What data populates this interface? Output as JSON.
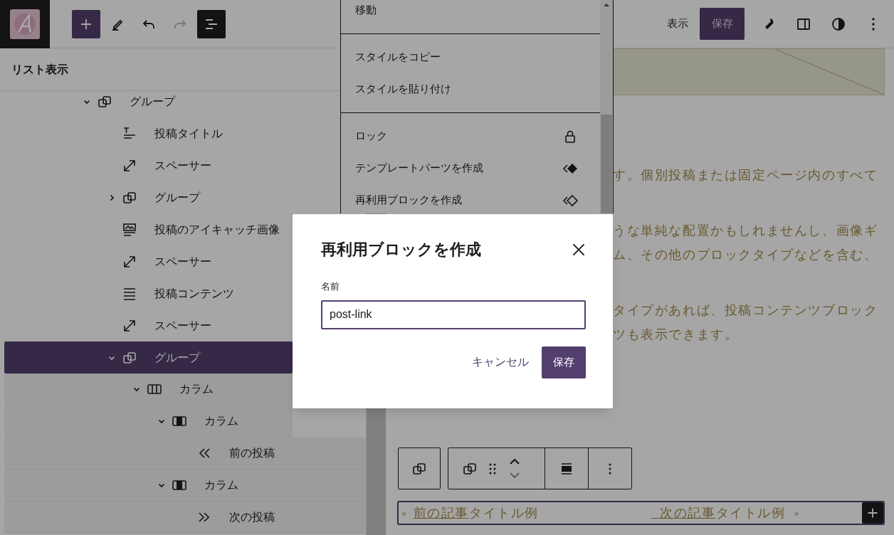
{
  "toolbar": {
    "tools": [
      {
        "kind": "inserter",
        "disabled": false,
        "pressed": false
      },
      {
        "kind": "tools",
        "disabled": false,
        "pressed": false
      },
      {
        "kind": "undo",
        "disabled": false,
        "pressed": false
      },
      {
        "kind": "redo",
        "disabled": true,
        "pressed": false
      },
      {
        "kind": "list-view",
        "disabled": false,
        "pressed": true
      }
    ],
    "view_button": "表示",
    "save_button": "保存",
    "actions": [
      {
        "kind": "settings"
      },
      {
        "kind": "sidebar"
      },
      {
        "kind": "styles"
      },
      {
        "kind": "options"
      }
    ]
  },
  "list_view": {
    "title": "リスト表示",
    "items": [
      {
        "label": "グループ",
        "kind": "group",
        "expanded": true,
        "selected": false,
        "children": [
          {
            "label": "投稿タイトル",
            "kind": "post-title",
            "selected": false
          },
          {
            "label": "スペーサー",
            "kind": "spacer",
            "selected": false
          },
          {
            "label": "グループ",
            "kind": "group",
            "expanded": false,
            "selected": false
          },
          {
            "label": "投稿のアイキャッチ画像",
            "kind": "featured-image",
            "selected": false
          },
          {
            "label": "スペーサー",
            "kind": "spacer",
            "selected": false
          },
          {
            "label": "投稿コンテンツ",
            "kind": "post-content",
            "selected": false
          },
          {
            "label": "スペーサー",
            "kind": "spacer",
            "selected": false
          },
          {
            "label": "グループ",
            "kind": "group",
            "expanded": true,
            "selected": true,
            "children": [
              {
                "label": "カラム",
                "kind": "columns",
                "expanded": true,
                "selected": false,
                "children": [
                  {
                    "label": "カラム",
                    "kind": "column",
                    "expanded": true,
                    "selected": false,
                    "children": [
                      {
                        "label": "前の投稿",
                        "kind": "previous-post",
                        "selected": false
                      }
                    ]
                  },
                  {
                    "label": "カラム",
                    "kind": "column",
                    "expanded": true,
                    "selected": false,
                    "children": [
                      {
                        "label": "次の投稿",
                        "kind": "next-post",
                        "selected": false
                      }
                    ]
                  }
                ]
              }
            ]
          }
        ]
      }
    ]
  },
  "block_menu": {
    "groups": [
      [
        {
          "label": "移動",
          "kind": "plain"
        }
      ],
      [
        {
          "label": "スタイルをコピー",
          "kind": "plain"
        },
        {
          "label": "スタイルを貼り付け",
          "kind": "plain"
        }
      ],
      [
        {
          "label": "ロック",
          "kind": "lock"
        },
        {
          "label": "テンプレートパーツを作成",
          "kind": "template-part"
        },
        {
          "label": "再利用ブロックを作成",
          "kind": "reusable"
        }
      ]
    ]
  },
  "editor": {
    "paragraphs": [
      {
        "lines": [
          "す。個別投稿または固定ページ内のすべて"
        ]
      },
      {
        "lines": [
          "うな単純な配置かもしれませんし、画像ギ",
          "ム、その他のブロックタイプなどを含む、"
        ]
      },
      {
        "lines": [
          "タイプがあれば、投稿コンテンツブロック",
          "ツも表示できます。"
        ]
      }
    ],
    "block_toolbar": {
      "move_up_disabled": false,
      "move_down_disabled": true
    },
    "post_navigation": {
      "previous": {
        "arrow": "«",
        "link": "前の記事",
        "title": "タイトル例"
      },
      "next": {
        "link": "  次の記事",
        "title": "タイトル例",
        "arrow": "»"
      }
    }
  },
  "modal": {
    "title": "再利用ブロックを作成",
    "field_label": "名前",
    "field_value": "post-link",
    "cancel_button": "キャンセル",
    "save_button": "保存"
  }
}
